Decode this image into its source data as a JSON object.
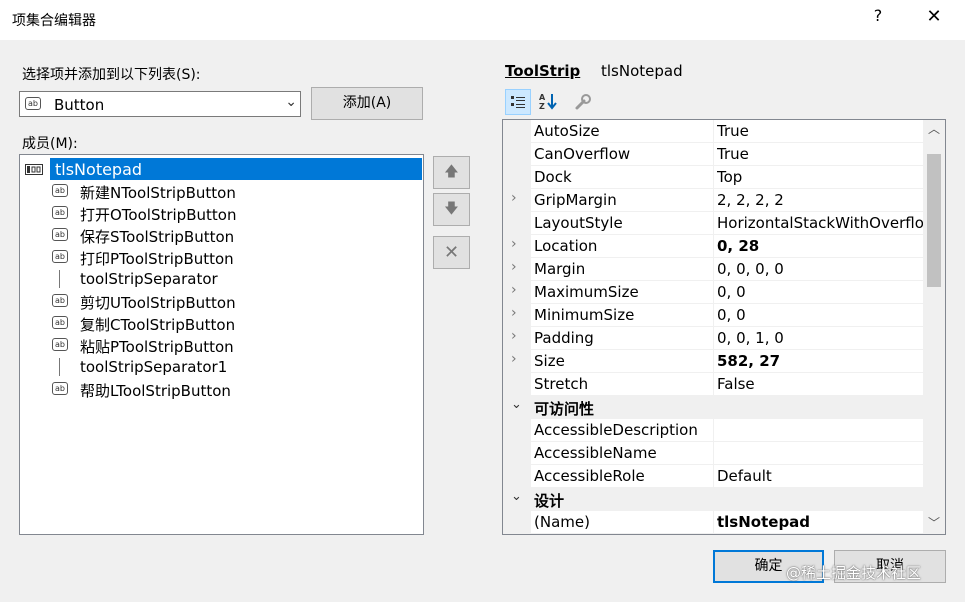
{
  "window": {
    "title": "项集合编辑器",
    "help": "?",
    "close": "✕"
  },
  "left": {
    "select_label": "选择项并添加到以下列表(S):",
    "combo_value": "Button",
    "add_button": "添加(A)",
    "members_label": "成员(M):",
    "root_member": "tlsNotepad",
    "members": [
      {
        "icon": "button",
        "label": "新建NToolStripButton"
      },
      {
        "icon": "button",
        "label": "打开OToolStripButton"
      },
      {
        "icon": "button",
        "label": "保存SToolStripButton"
      },
      {
        "icon": "button",
        "label": "打印PToolStripButton"
      },
      {
        "icon": "separator",
        "label": "toolStripSeparator"
      },
      {
        "icon": "button",
        "label": "剪切UToolStripButton"
      },
      {
        "icon": "button",
        "label": "复制CToolStripButton"
      },
      {
        "icon": "button",
        "label": "粘贴PToolStripButton"
      },
      {
        "icon": "separator",
        "label": "toolStripSeparator1"
      },
      {
        "icon": "button",
        "label": "帮助LToolStripButton"
      }
    ],
    "icon_text": "ab",
    "move_up": "🡅",
    "move_down": "🡇",
    "delete": "✕"
  },
  "right": {
    "type_label": "ToolStrip",
    "object_name": "tlsNotepad",
    "properties": [
      {
        "name": "AutoSize",
        "value": "True",
        "expandable": false,
        "bold": false
      },
      {
        "name": "CanOverflow",
        "value": "True",
        "expandable": false,
        "bold": false
      },
      {
        "name": "Dock",
        "value": "Top",
        "expandable": false,
        "bold": false
      },
      {
        "name": "GripMargin",
        "value": "2, 2, 2, 2",
        "expandable": true,
        "bold": false
      },
      {
        "name": "LayoutStyle",
        "value": "HorizontalStackWithOverflow",
        "expandable": false,
        "bold": false
      },
      {
        "name": "Location",
        "value": "0, 28",
        "expandable": true,
        "bold": true
      },
      {
        "name": "Margin",
        "value": "0, 0, 0, 0",
        "expandable": true,
        "bold": false
      },
      {
        "name": "MaximumSize",
        "value": "0, 0",
        "expandable": true,
        "bold": false
      },
      {
        "name": "MinimumSize",
        "value": "0, 0",
        "expandable": true,
        "bold": false
      },
      {
        "name": "Padding",
        "value": "0, 0, 1, 0",
        "expandable": true,
        "bold": false
      },
      {
        "name": "Size",
        "value": "582, 27",
        "expandable": true,
        "bold": true
      },
      {
        "name": "Stretch",
        "value": "False",
        "expandable": false,
        "bold": false
      },
      {
        "category": "可访问性"
      },
      {
        "name": "AccessibleDescription",
        "value": "",
        "expandable": false,
        "bold": false
      },
      {
        "name": "AccessibleName",
        "value": "",
        "expandable": false,
        "bold": false
      },
      {
        "name": "AccessibleRole",
        "value": "Default",
        "expandable": false,
        "bold": false
      },
      {
        "category": "设计"
      },
      {
        "name": "(Name)",
        "value": "tlsNotepad",
        "expandable": false,
        "bold": true
      }
    ]
  },
  "footer": {
    "ok_button": "确定",
    "cancel_button": "取消"
  },
  "watermark": "@稀土掘金技术社区",
  "colors": {
    "selection": "#0078d7",
    "background": "#f0f0f0"
  }
}
